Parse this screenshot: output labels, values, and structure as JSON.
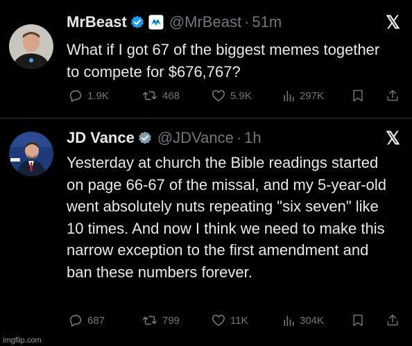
{
  "tweets": [
    {
      "name": "MrBeast",
      "handle": "@MrBeast",
      "separator": "·",
      "time": "51m",
      "text": "What if I got 67 of the biggest memes together to compete for $676,767?",
      "stats": {
        "replies": "1.9K",
        "reposts": "468",
        "likes": "5.9K",
        "views": "297K"
      }
    },
    {
      "name": "JD Vance",
      "handle": "@JDVance",
      "separator": "·",
      "time": "1h",
      "text": "Yesterday at church the Bible readings started on page 66-67 of the missal, and my 5-year-old went absolutely nuts repeating \"six seven\" like 10 times. And now I think we need to make this narrow exception to the first amendment and ban these numbers forever.",
      "stats": {
        "replies": "687",
        "reposts": "799",
        "likes": "11K",
        "views": "304K"
      }
    }
  ],
  "platform_logo": "𝕏",
  "watermark": "imgflip.com",
  "colors": {
    "background": "#000000",
    "text": "#e7e9ea",
    "muted": "#71767b",
    "verified_blue": "#1d9bf0",
    "verified_gray": "#829aab"
  }
}
